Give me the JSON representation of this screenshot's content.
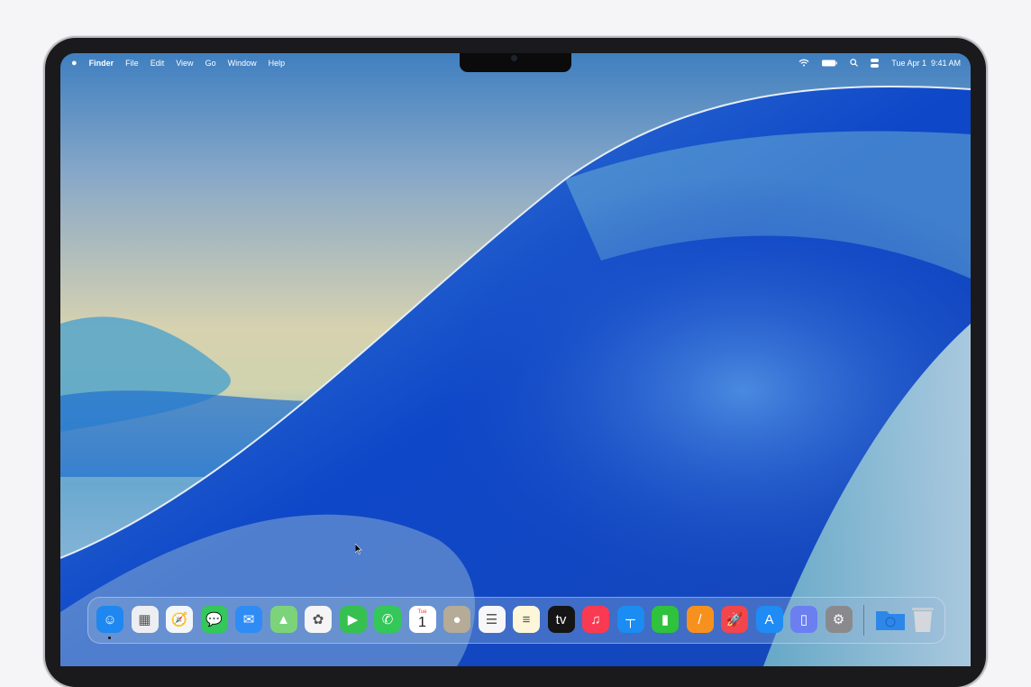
{
  "menubar": {
    "app_name": "Finder",
    "items": [
      "File",
      "Edit",
      "View",
      "Go",
      "Window",
      "Help"
    ],
    "clock": "Tue Apr 1  9:41 AM"
  },
  "dock": {
    "apps": [
      {
        "name": "Finder",
        "color": "#1e88f0",
        "glyph": "☺"
      },
      {
        "name": "Launchpad",
        "color": "#eceef2",
        "glyph": "▦"
      },
      {
        "name": "Safari",
        "color": "#f3f6fb",
        "glyph": "🧭"
      },
      {
        "name": "Messages",
        "color": "#34c759",
        "glyph": "💬"
      },
      {
        "name": "Mail",
        "color": "#2f8cf5",
        "glyph": "✉"
      },
      {
        "name": "Maps",
        "color": "#7cd37a",
        "glyph": "▲"
      },
      {
        "name": "Photos",
        "color": "#f5f5f5",
        "glyph": "✿"
      },
      {
        "name": "FaceTime",
        "color": "#35c04f",
        "glyph": "▶"
      },
      {
        "name": "Phone",
        "color": "#34c759",
        "glyph": "✆"
      },
      {
        "name": "Calendar",
        "color": "#ffffff",
        "glyph": "1"
      },
      {
        "name": "Contacts",
        "color": "#b5ab96",
        "glyph": "●"
      },
      {
        "name": "Reminders",
        "color": "#f7f7f9",
        "glyph": "☰"
      },
      {
        "name": "Notes",
        "color": "#fdf6d8",
        "glyph": "≡"
      },
      {
        "name": "TV",
        "color": "#151515",
        "glyph": "tv"
      },
      {
        "name": "Music",
        "color": "#fa3a52",
        "glyph": "♫"
      },
      {
        "name": "Keynote",
        "color": "#1a8cf2",
        "glyph": "┬"
      },
      {
        "name": "Numbers",
        "color": "#2fc23c",
        "glyph": "▮"
      },
      {
        "name": "Pages",
        "color": "#f7911e",
        "glyph": "/"
      },
      {
        "name": "Rocket",
        "color": "#f2454c",
        "glyph": "🚀"
      },
      {
        "name": "App Store",
        "color": "#1f8bf4",
        "glyph": "A"
      },
      {
        "name": "iPhone Mirroring",
        "color": "#6b7ff0",
        "glyph": "▯"
      },
      {
        "name": "System Settings",
        "color": "#8a8a8e",
        "glyph": "⚙"
      }
    ],
    "calendar_month": "Tue",
    "stack": {
      "name": "Downloads",
      "color": "#2d87e8"
    },
    "trash": {
      "name": "Trash",
      "color": "#c9ccd1"
    }
  }
}
